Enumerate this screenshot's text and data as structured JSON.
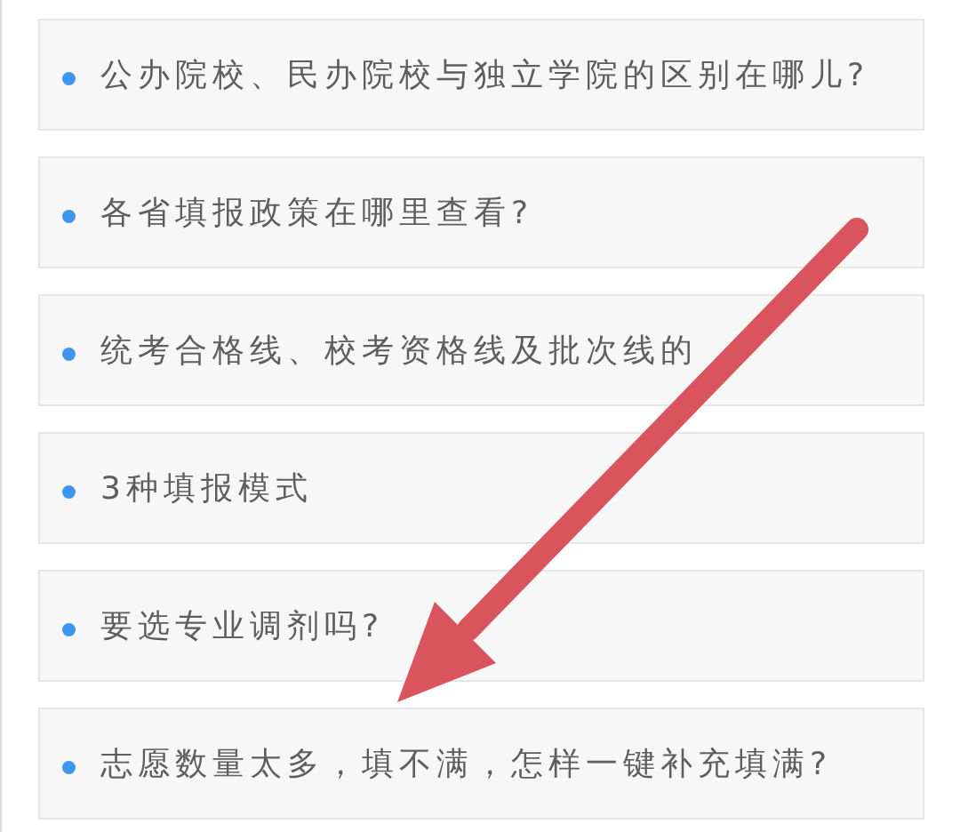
{
  "items": [
    {
      "text": "公办院校、民办院校与独立学院的区别在哪儿?"
    },
    {
      "text": "各省填报政策在哪里查看?"
    },
    {
      "text": "统考合格线、校考资格线及批次线的"
    },
    {
      "text": "3种填报模式"
    },
    {
      "text": "要选专业调剂吗?"
    },
    {
      "text": "志愿数量太多，填不满，怎样一键补充填满?"
    }
  ],
  "annotation": {
    "kind": "arrow"
  }
}
